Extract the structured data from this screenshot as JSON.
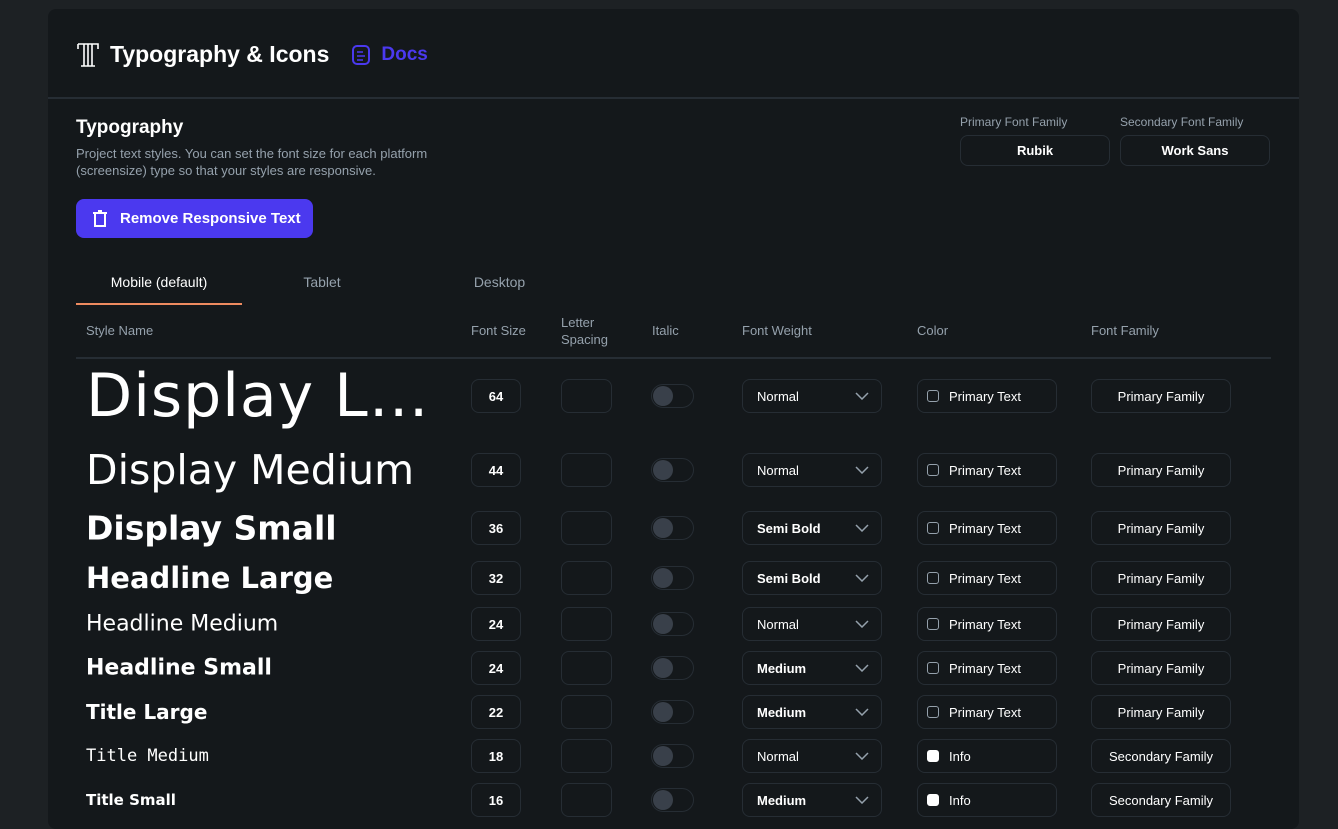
{
  "header": {
    "title": "Typography & Icons",
    "docs": "Docs"
  },
  "section": {
    "title": "Typography",
    "description": "Project text styles. You can set the font size for each platform (screensize) type so that your styles are responsive.",
    "remove_button": "Remove Responsive Text"
  },
  "fonts": {
    "primary_label": "Primary Font Family",
    "primary_value": "Rubik",
    "secondary_label": "Secondary Font Family",
    "secondary_value": "Work Sans"
  },
  "tabs": [
    "Mobile (default)",
    "Tablet",
    "Desktop"
  ],
  "columns": [
    "Style Name",
    "Font Size",
    "Letter Spacing",
    "Italic",
    "Font Weight",
    "Color",
    "Font Family"
  ],
  "rows": [
    {
      "name": "Display Large",
      "size": "64",
      "weight": "Normal",
      "color": "Primary Text",
      "family": "Primary Family"
    },
    {
      "name": "Display Medium",
      "size": "44",
      "weight": "Normal",
      "color": "Primary Text",
      "family": "Primary Family"
    },
    {
      "name": "Display Small",
      "size": "36",
      "weight": "Semi Bold",
      "color": "Primary Text",
      "family": "Primary Family"
    },
    {
      "name": "Headline Large",
      "size": "32",
      "weight": "Semi Bold",
      "color": "Primary Text",
      "family": "Primary Family"
    },
    {
      "name": "Headline Medium",
      "size": "24",
      "weight": "Normal",
      "color": "Primary Text",
      "family": "Primary Family"
    },
    {
      "name": "Headline Small",
      "size": "24",
      "weight": "Medium",
      "color": "Primary Text",
      "family": "Primary Family"
    },
    {
      "name": "Title Large",
      "size": "22",
      "weight": "Medium",
      "color": "Primary Text",
      "family": "Primary Family"
    },
    {
      "name": "Title Medium",
      "size": "18",
      "weight": "Normal",
      "color": "Info",
      "family": "Secondary Family"
    },
    {
      "name": "Title Small",
      "size": "16",
      "weight": "Medium",
      "color": "Info",
      "family": "Secondary Family"
    }
  ],
  "colors": {
    "accent": "#4b39ef",
    "tab_indicator": "#ee8b60",
    "info": "#ffffff"
  }
}
